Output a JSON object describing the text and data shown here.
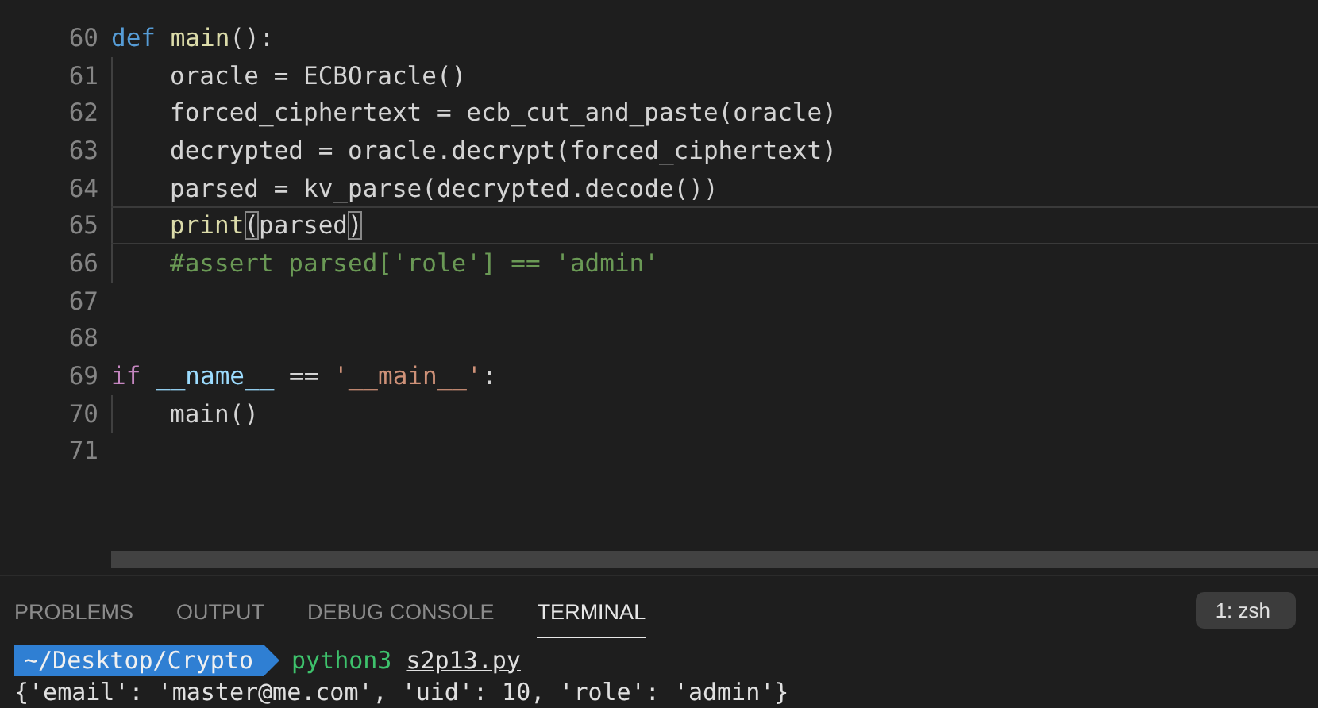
{
  "editor": {
    "lines": [
      {
        "number": "60",
        "guide": false,
        "current": false,
        "tokens": [
          {
            "kind": "keyword",
            "text": "def"
          },
          {
            "kind": "func",
            "text": " main"
          },
          {
            "kind": "plain",
            "text": "():"
          }
        ]
      },
      {
        "number": "61",
        "guide": true,
        "current": false,
        "tokens": [
          {
            "kind": "plain",
            "text": "oracle = ECBOracle()"
          }
        ]
      },
      {
        "number": "62",
        "guide": true,
        "current": false,
        "tokens": [
          {
            "kind": "plain",
            "text": "forced_ciphertext = ecb_cut_and_paste(oracle)"
          }
        ]
      },
      {
        "number": "63",
        "guide": true,
        "current": false,
        "tokens": [
          {
            "kind": "plain",
            "text": "decrypted = oracle.decrypt(forced_ciphertext)"
          }
        ]
      },
      {
        "number": "64",
        "guide": true,
        "current": false,
        "tokens": [
          {
            "kind": "plain",
            "text": "parsed = kv_parse(decrypted.decode())"
          }
        ]
      },
      {
        "number": "65",
        "guide": true,
        "current": true,
        "tokens": [
          {
            "kind": "func",
            "text": "print"
          },
          {
            "kind": "bracket",
            "text": "("
          },
          {
            "kind": "plain",
            "text": "parsed"
          },
          {
            "kind": "bracket",
            "text": ")"
          }
        ]
      },
      {
        "number": "66",
        "guide": true,
        "current": false,
        "tokens": [
          {
            "kind": "comment",
            "text": "#assert parsed['role'] == 'admin'"
          }
        ]
      },
      {
        "number": "67",
        "guide": false,
        "current": false
      },
      {
        "number": "68",
        "guide": false,
        "current": false
      },
      {
        "number": "69",
        "guide": false,
        "current": false,
        "tokens": [
          {
            "kind": "control",
            "text": "if"
          },
          {
            "kind": "variable",
            "text": " __name__"
          },
          {
            "kind": "plain",
            "text": " == "
          },
          {
            "kind": "string",
            "text": "'__main__'"
          },
          {
            "kind": "plain",
            "text": ":"
          }
        ]
      },
      {
        "number": "70",
        "guide": true,
        "current": false,
        "tokens": [
          {
            "kind": "plain",
            "text": "main()"
          }
        ]
      },
      {
        "number": "71",
        "guide": false,
        "current": false
      }
    ]
  },
  "panel": {
    "tabs": [
      {
        "label": "PROBLEMS",
        "selected": false
      },
      {
        "label": "OUTPUT",
        "selected": false
      },
      {
        "label": "DEBUG CONSOLE",
        "selected": false
      },
      {
        "label": "TERMINAL",
        "selected": true
      }
    ],
    "terminal_select": "1: zsh",
    "terminal": {
      "prompt_path": "~/Desktop/Crypto",
      "command": "python3",
      "argument": "s2p13.py",
      "output": "{'email': 'master@me.com', 'uid': 10, 'role': 'admin'}"
    }
  }
}
